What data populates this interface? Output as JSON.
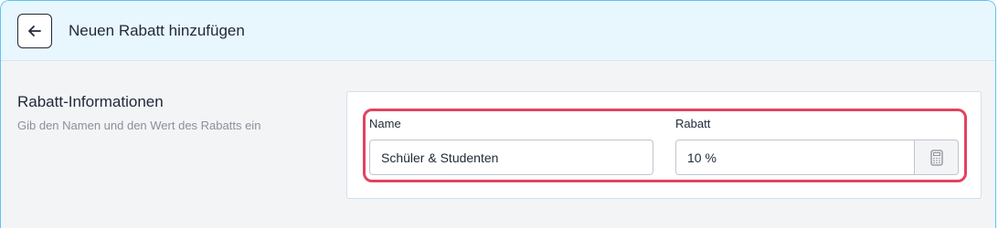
{
  "header": {
    "title": "Neuen Rabatt hinzufügen",
    "back_icon": "arrow-left-icon"
  },
  "section": {
    "title": "Rabatt-Informationen",
    "description": "Gib den Namen und den Wert des Rabatts ein"
  },
  "form": {
    "name": {
      "label": "Name",
      "value": "Schüler & Studenten"
    },
    "discount": {
      "label": "Rabatt",
      "value": "10 %",
      "addon_icon": "calculator-icon"
    }
  },
  "colors": {
    "header_bg": "#e8f6fd",
    "page_bg": "#f3f4f6",
    "frame_border": "#5fc3ee",
    "highlight": "#e0445e"
  }
}
